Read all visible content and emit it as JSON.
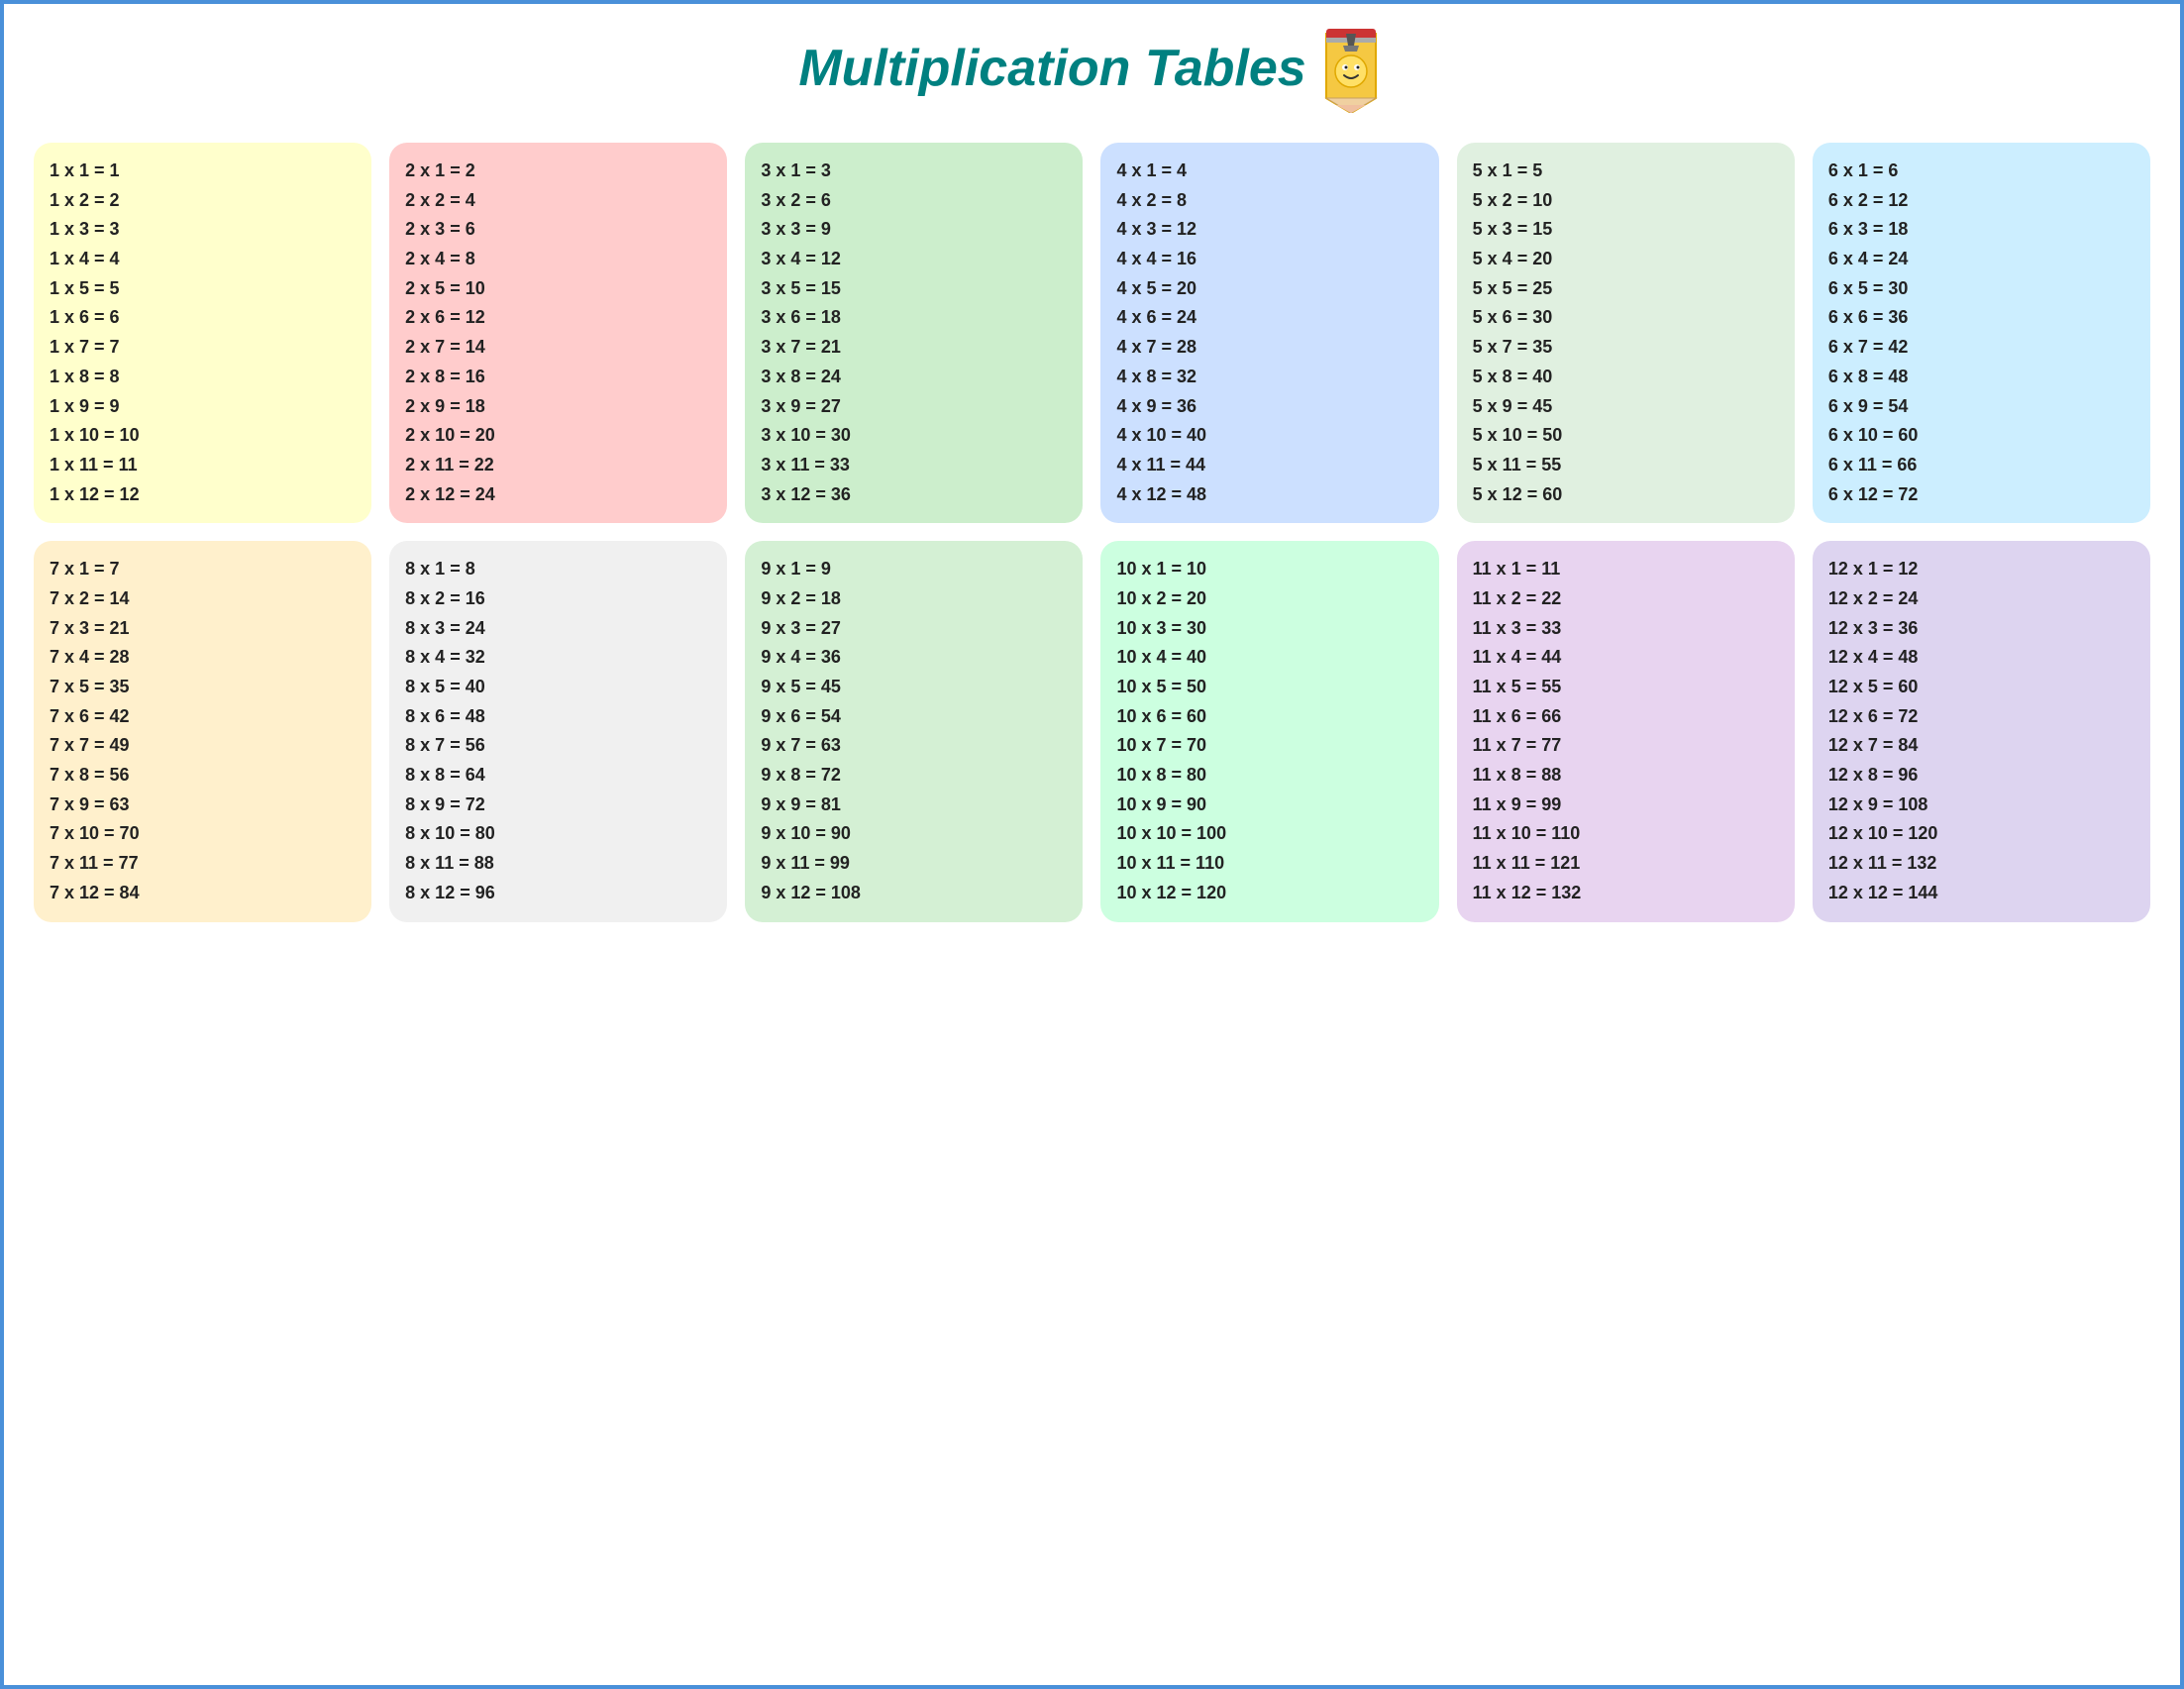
{
  "title": "Multiplication Tables",
  "tables": [
    {
      "id": 1,
      "cardClass": "card-1",
      "rows": [
        "1 x 1 = 1",
        "1 x 2 = 2",
        "1 x 3 = 3",
        "1 x 4 = 4",
        "1 x 5 = 5",
        "1 x 6 = 6",
        "1 x 7 = 7",
        "1 x 8 = 8",
        "1 x 9 = 9",
        "1 x 10 = 10",
        "1 x 11 = 11",
        "1 x 12 = 12"
      ]
    },
    {
      "id": 2,
      "cardClass": "card-2",
      "rows": [
        "2 x 1 = 2",
        "2 x 2 = 4",
        "2 x 3 = 6",
        "2 x 4 = 8",
        "2 x 5 = 10",
        "2 x 6 = 12",
        "2 x 7 = 14",
        "2 x 8 = 16",
        "2 x 9 = 18",
        "2 x 10 = 20",
        "2 x 11 = 22",
        "2 x 12 = 24"
      ]
    },
    {
      "id": 3,
      "cardClass": "card-3",
      "rows": [
        "3 x 1 = 3",
        "3 x 2 = 6",
        "3 x 3 = 9",
        "3 x 4 = 12",
        "3 x 5 = 15",
        "3 x 6 = 18",
        "3 x 7 = 21",
        "3 x 8 = 24",
        "3 x 9 = 27",
        "3 x 10 = 30",
        "3 x 11 = 33",
        "3 x 12 = 36"
      ]
    },
    {
      "id": 4,
      "cardClass": "card-4",
      "rows": [
        "4 x 1 = 4",
        "4 x 2 = 8",
        "4 x 3 = 12",
        "4 x 4 = 16",
        "4 x 5 = 20",
        "4 x 6 = 24",
        "4 x 7 = 28",
        "4 x 8 = 32",
        "4 x 9 = 36",
        "4 x 10 = 40",
        "4 x 11 = 44",
        "4 x 12 = 48"
      ]
    },
    {
      "id": 5,
      "cardClass": "card-5",
      "rows": [
        "5 x 1 = 5",
        "5 x 2 = 10",
        "5 x 3 = 15",
        "5 x 4 = 20",
        "5 x 5 = 25",
        "5 x 6 = 30",
        "5 x 7 = 35",
        "5 x 8 = 40",
        "5 x 9 = 45",
        "5 x 10 = 50",
        "5 x 11 = 55",
        "5 x 12 = 60"
      ]
    },
    {
      "id": 6,
      "cardClass": "card-6",
      "rows": [
        "6 x 1 = 6",
        "6 x 2 = 12",
        "6 x 3 = 18",
        "6 x 4 = 24",
        "6 x 5 = 30",
        "6 x 6 = 36",
        "6 x 7 = 42",
        "6 x 8 = 48",
        "6 x 9 = 54",
        "6 x 10 = 60",
        "6 x 11 = 66",
        "6 x 12 = 72"
      ]
    },
    {
      "id": 7,
      "cardClass": "card-7",
      "rows": [
        "7 x 1 = 7",
        "7 x 2 = 14",
        "7 x 3 = 21",
        "7 x 4 = 28",
        "7 x 5 = 35",
        "7 x 6 = 42",
        "7 x 7 = 49",
        "7 x 8 = 56",
        "7 x 9 = 63",
        "7 x 10 = 70",
        "7 x 11 = 77",
        "7 x 12 = 84"
      ]
    },
    {
      "id": 8,
      "cardClass": "card-8",
      "rows": [
        "8 x 1 = 8",
        "8 x 2 = 16",
        "8 x 3 = 24",
        "8 x 4 = 32",
        "8 x 5 = 40",
        "8 x 6 = 48",
        "8 x 7 = 56",
        "8 x 8 = 64",
        "8 x 9 = 72",
        "8 x 10 = 80",
        "8 x 11 = 88",
        "8 x 12 = 96"
      ]
    },
    {
      "id": 9,
      "cardClass": "card-9",
      "rows": [
        "9 x 1 = 9",
        "9 x 2 = 18",
        "9 x 3 = 27",
        "9 x 4 = 36",
        "9 x 5 = 45",
        "9 x 6 = 54",
        "9 x 7 = 63",
        "9 x 8 = 72",
        "9 x 9 = 81",
        "9 x 10 = 90",
        "9 x 11 = 99",
        "9 x 12 = 108"
      ]
    },
    {
      "id": 10,
      "cardClass": "card-10",
      "rows": [
        "10 x 1 = 10",
        "10 x 2 = 20",
        "10 x 3 = 30",
        "10 x 4 = 40",
        "10 x 5 = 50",
        "10 x 6 = 60",
        "10 x 7 = 70",
        "10 x 8 = 80",
        "10 x 9 = 90",
        "10 x 10 = 100",
        "10 x 11 = 110",
        "10 x 12 = 120"
      ]
    },
    {
      "id": 11,
      "cardClass": "card-11",
      "rows": [
        "11 x 1 = 11",
        "11 x 2 = 22",
        "11 x 3 = 33",
        "11 x 4 = 44",
        "11 x 5 = 55",
        "11 x 6 = 66",
        "11 x 7 = 77",
        "11 x 8 = 88",
        "11 x 9 = 99",
        "11 x 10 = 110",
        "11 x 11 = 121",
        "11 x 12 = 132"
      ]
    },
    {
      "id": 12,
      "cardClass": "card-12",
      "rows": [
        "12 x 1 = 12",
        "12 x 2 = 24",
        "12 x 3 = 36",
        "12 x 4 = 48",
        "12 x 5 = 60",
        "12 x 6 = 72",
        "12 x 7 = 84",
        "12 x 8 = 96",
        "12 x 9 = 108",
        "12 x 10 = 120",
        "12 x 11 = 132",
        "12 x 12 = 144"
      ]
    }
  ]
}
